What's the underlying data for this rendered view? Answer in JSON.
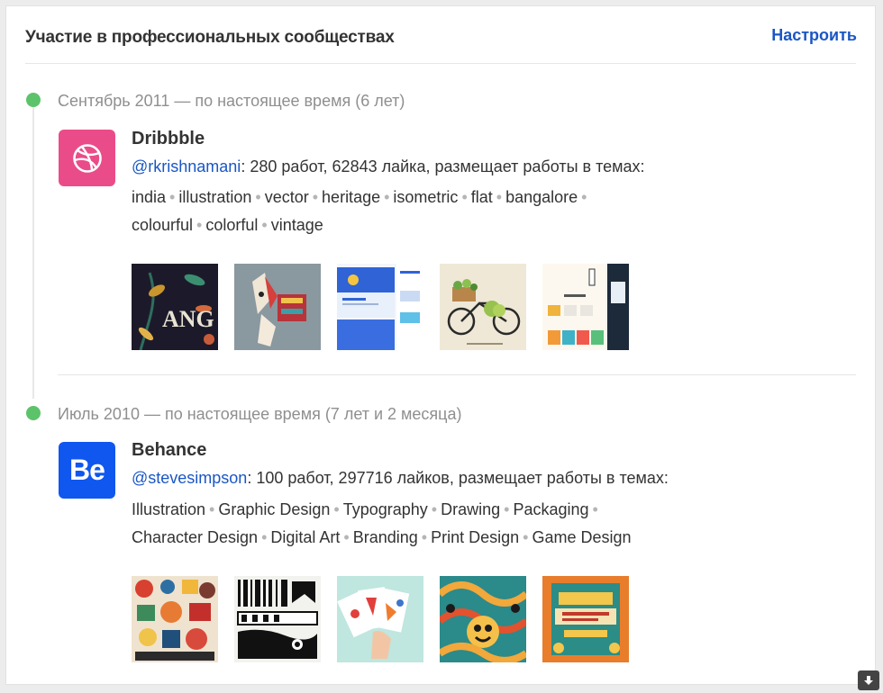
{
  "header": {
    "title": "Участие в профессиональных сообществах",
    "settings_label": "Настроить"
  },
  "colors": {
    "accent_link": "#1a56c4",
    "timeline_dot": "#5cc36b",
    "dribbble_pink": "#ea4c89",
    "behance_blue": "#1057f0"
  },
  "communities": [
    {
      "period": "Сентябрь 2011 — по настоящее время (6 лет)",
      "name": "Dribbble",
      "logo_icon": "dribbble-ball-icon",
      "handle": "@rkrishnamani",
      "stats": ": 280 работ, 62843 лайка, размещает работы в темах:",
      "tags": [
        "india",
        "illustration",
        "vector",
        "heritage",
        "isometric",
        "flat",
        "bangalore",
        "colourful",
        "colorful",
        "vintage"
      ],
      "thumbnails": [
        "mango-lettering",
        "decorated-cow",
        "web-landing-page",
        "bicycle-basket",
        "insights-web-ui"
      ]
    },
    {
      "period": "Июль 2010 — по настоящее время (7 лет и 2 месяца)",
      "name": "Behance",
      "logo_text": "Be",
      "handle": "@stevesimpson",
      "stats": ": 100 работ, 297716 лайков, размещает работы в темах:",
      "tags": [
        "Illustration",
        "Graphic Design",
        "Typography",
        "Drawing",
        "Packaging",
        "Character Design",
        "Digital Art",
        "Branding",
        "Print Design",
        "Game Design"
      ],
      "thumbnails": [
        "illustrated-collage",
        "black-white-typography",
        "playing-cards",
        "psychedelic-pattern",
        "successful-illustrator-poster"
      ]
    }
  ]
}
